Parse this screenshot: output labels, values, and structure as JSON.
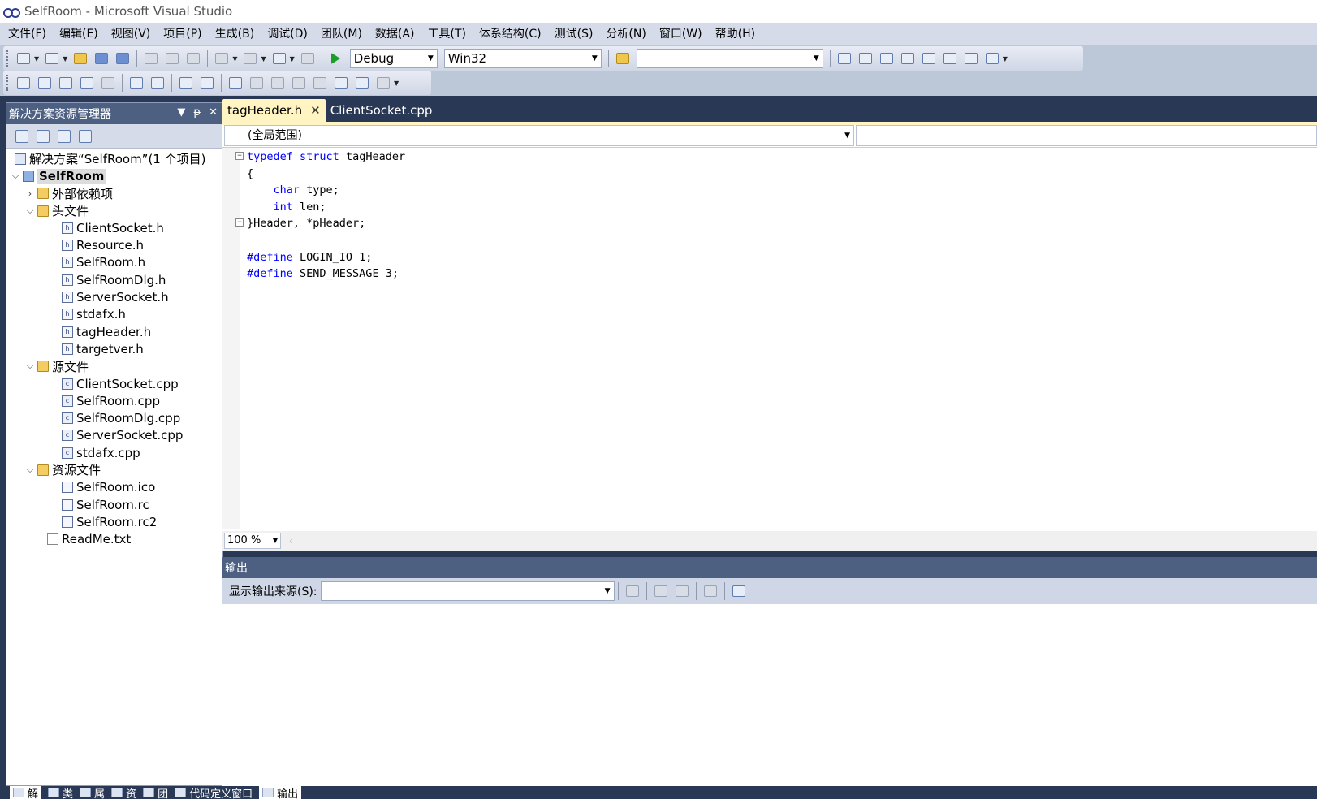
{
  "window": {
    "title": "SelfRoom - Microsoft Visual Studio"
  },
  "menu": [
    "文件(F)",
    "编辑(E)",
    "视图(V)",
    "项目(P)",
    "生成(B)",
    "调试(D)",
    "团队(M)",
    "数据(A)",
    "工具(T)",
    "体系结构(C)",
    "测试(S)",
    "分析(N)",
    "窗口(W)",
    "帮助(H)"
  ],
  "toolbar": {
    "config_value": "Debug",
    "platform_value": "Win32",
    "find_value": ""
  },
  "solution_explorer": {
    "title": "解决方案资源管理器",
    "pin_glyph": "ᵽ",
    "close_glyph": "✕",
    "solution_label": "解决方案“SelfRoom”(1 个项目)",
    "project_label": "SelfRoom",
    "ext_deps_label": "外部依赖项",
    "headers_folder": "头文件",
    "headers": [
      "ClientSocket.h",
      "Resource.h",
      "SelfRoom.h",
      "SelfRoomDlg.h",
      "ServerSocket.h",
      "stdafx.h",
      "tagHeader.h",
      "targetver.h"
    ],
    "sources_folder": "源文件",
    "sources": [
      "ClientSocket.cpp",
      "SelfRoom.cpp",
      "SelfRoomDlg.cpp",
      "ServerSocket.cpp",
      "stdafx.cpp"
    ],
    "resources_folder": "资源文件",
    "resources": [
      "SelfRoom.ico",
      "SelfRoom.rc",
      "SelfRoom.rc2"
    ],
    "readme": "ReadMe.txt"
  },
  "editor": {
    "tabs": [
      {
        "label": "tagHeader.h",
        "active": true
      },
      {
        "label": "ClientSocket.cpp",
        "active": false
      }
    ],
    "scope_value": "(全局范围)",
    "zoom_value": "100 %",
    "code": {
      "l1_kw1": "typedef",
      "l1_kw2": "struct",
      "l1_rest": " tagHeader",
      "l2": "{",
      "l3_kw": "char",
      "l3_rest": " type;",
      "l4_kw": "int",
      "l4_rest": " len;",
      "l5": "}Header, *pHeader;",
      "l7_kw": "#define",
      "l7_rest": " LOGIN_IO 1;",
      "l8_kw": "#define",
      "l8_rest": " SEND_MESSAGE 3;"
    }
  },
  "output": {
    "title": "输出",
    "source_label": "显示输出来源(S):",
    "source_value": ""
  },
  "bottom_tabs": [
    "解",
    "类",
    "属",
    "资",
    "团",
    "代码定义窗口",
    "输出"
  ],
  "colors": {
    "frame": "#293955",
    "panel_header": "#4d6082",
    "active_tab": "#fff4c2",
    "keyword": "#0000ff"
  }
}
